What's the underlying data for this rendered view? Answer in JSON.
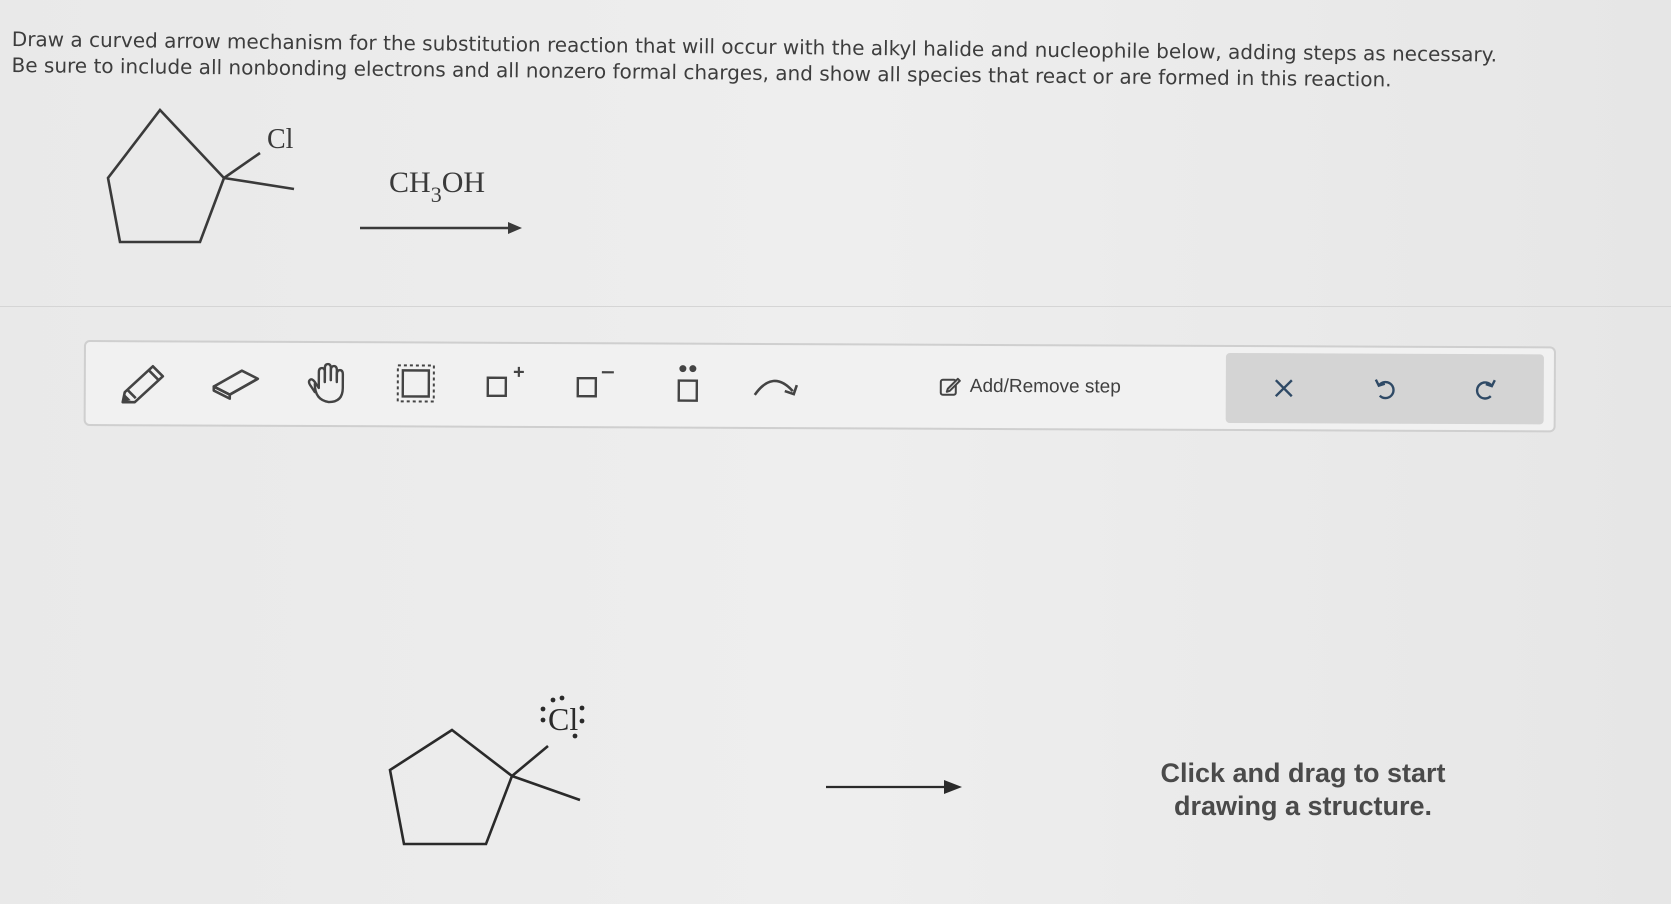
{
  "instructions": {
    "line1": "Draw a curved arrow mechanism for the substitution reaction that will occur with the alkyl halide and nucleophile below, adding steps as necessary.",
    "line2": "Be sure to include all nonbonding electrons and all nonzero formal charges, and show all species that react or are formed in this reaction."
  },
  "problem": {
    "substituent_label": "Cl",
    "reagent_main": "CH",
    "reagent_subscript": "3",
    "reagent_tail": "OH"
  },
  "toolbar": {
    "tools": [
      "pencil-icon",
      "eraser-icon",
      "hand-icon",
      "select-icon",
      "positive-charge-icon",
      "negative-charge-icon",
      "lone-pair-icon",
      "curved-arrow-icon"
    ],
    "add_remove_label": "Add/Remove step",
    "actions": [
      "close-icon",
      "undo-icon",
      "redo-icon"
    ]
  },
  "canvas": {
    "structure_atom_label": "Cl",
    "hint_line1": "Click and drag to start",
    "hint_line2": "drawing a structure."
  }
}
